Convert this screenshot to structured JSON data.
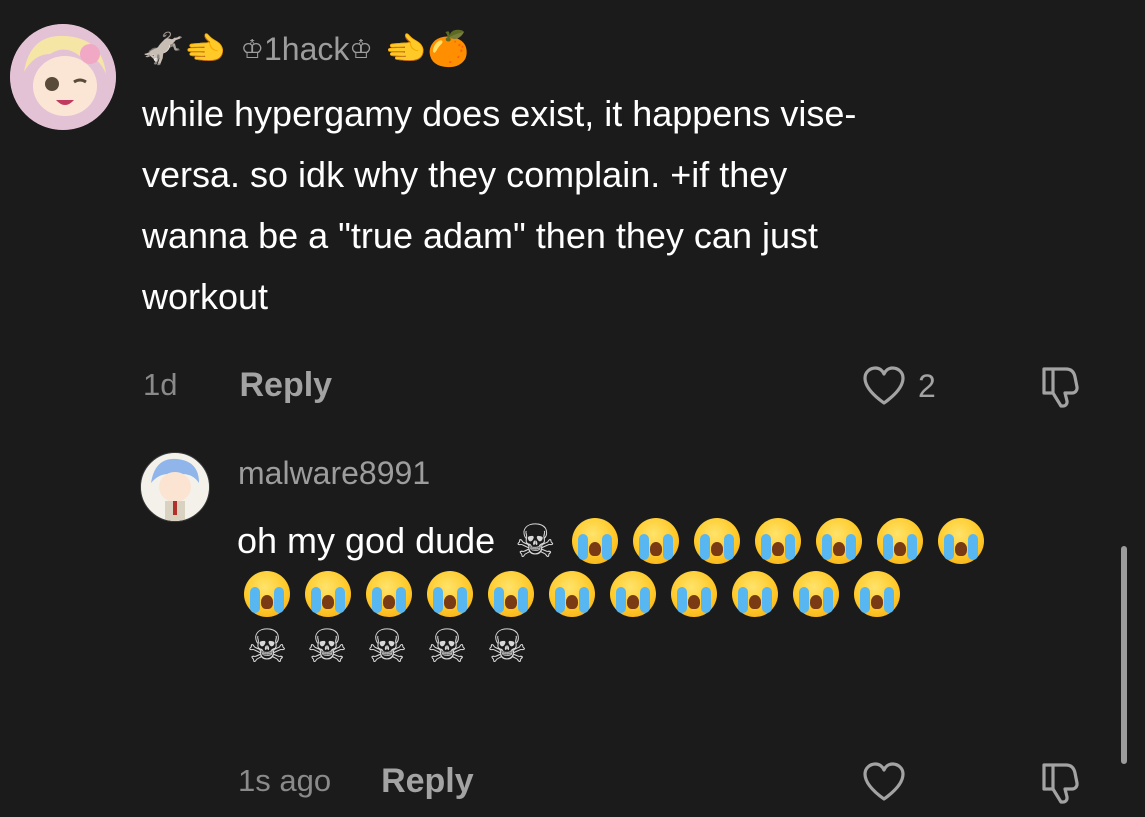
{
  "comments": [
    {
      "username": "1hack",
      "username_prefix_emojis": "🫏🫲",
      "crown_left": "♔",
      "crown_right": "♔",
      "username_suffix_emojis": "🫲🍊",
      "text": "while hypergamy does exist, it happens vise-\nversa. so idk why they complain. +if they\nwanna be a \"true adam\" then they can just\nworkout",
      "time": "1d",
      "reply_label": "Reply",
      "like_count": "2"
    },
    {
      "username": "malware8991",
      "text_prefix": "oh my god dude",
      "emoji_skull": "☠",
      "emoji_sob_name": "loudly-crying-face",
      "emoji_skull_name": "skull-and-crossbones",
      "sob_count_line1": 7,
      "sob_count_line2": 11,
      "skull_count_line3": 5,
      "time": "1s ago",
      "reply_label": "Reply",
      "like_count": ""
    }
  ],
  "colors": {
    "background": "#1b1b1b",
    "text": "#ffffff",
    "secondary": "#9d9d9d"
  }
}
